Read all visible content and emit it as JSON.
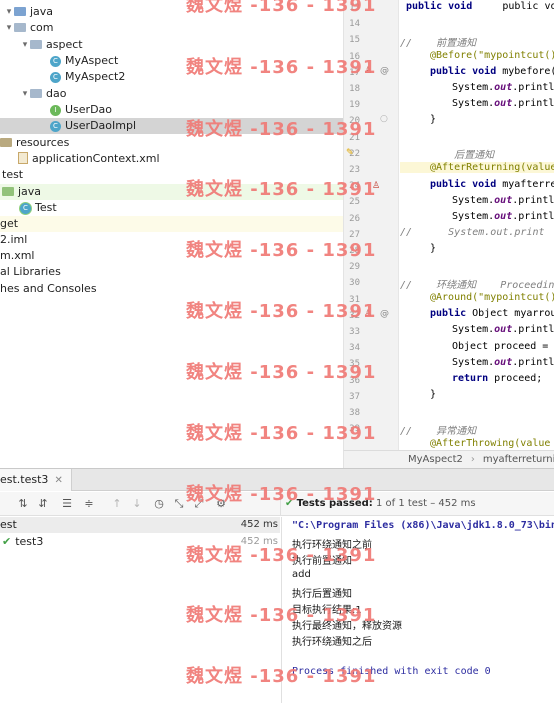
{
  "project_tree": [
    {
      "label": "java",
      "icon": "folder-icon",
      "indent": 0
    },
    {
      "label": "com",
      "icon": "folder-icon",
      "indent": 1
    },
    {
      "label": "aspect",
      "icon": "folder-icon",
      "indent": 2
    },
    {
      "label": "MyAspect",
      "icon": "class-icon",
      "indent": 3
    },
    {
      "label": "MyAspect2",
      "icon": "class-icon",
      "indent": 3
    },
    {
      "label": "dao",
      "icon": "folder-icon",
      "indent": 2
    },
    {
      "label": "UserDao",
      "icon": "interface-icon",
      "indent": 3
    },
    {
      "label": "UserDaoImpl",
      "icon": "class-icon",
      "indent": 3
    },
    {
      "label": "resources",
      "icon": "resources-folder-icon",
      "indent": 0
    },
    {
      "label": "applicationContext.xml",
      "icon": "xml-icon",
      "indent": 1
    },
    {
      "label": "test",
      "icon": "folder-icon",
      "indent": 0
    },
    {
      "label": "java",
      "icon": "test-folder-icon",
      "indent": 1
    },
    {
      "label": "Test",
      "icon": "test-class-icon",
      "indent": 2
    },
    {
      "label": "get",
      "icon": "folder-icon",
      "indent": 0
    },
    {
      "label": "2.iml",
      "icon": "file-icon",
      "indent": 0
    },
    {
      "label": "m.xml",
      "icon": "file-icon",
      "indent": 0
    },
    {
      "label": "al Libraries",
      "icon": "library-icon",
      "indent": 0
    },
    {
      "label": "hes and Consoles",
      "icon": "console-icon",
      "indent": 0
    }
  ],
  "editor": {
    "line_numbers": [
      "13",
      "14",
      "15",
      "16",
      "17",
      "18",
      "19",
      "20",
      "21",
      "22",
      "23",
      "24",
      "25",
      "26",
      "27",
      "28",
      "29",
      "30",
      "31",
      "32",
      "33",
      "34",
      "35",
      "36",
      "37",
      "38",
      "39"
    ],
    "lines": {
      "l13": "    public void mypointcut",
      "l15": "//    前置通知",
      "l16_ann": "@Before(\"mypointcut()\"",
      "l17_kw": "public void ",
      "l17_rest": "mybefore(J",
      "l18_a": "System.",
      "l18_fld": "out",
      "l18_b": ".println",
      "l19_a": "System.",
      "l19_fld": "out",
      "l19_b": ".println",
      "l20": "}",
      "l22": "    后置通知",
      "l23_ann": "@AfterReturning(value",
      "l24_kw": "public void ",
      "l24_rest": "myafterret",
      "l25_a": "System.",
      "l25_fld": "out",
      "l25_b": ".println",
      "l26_a": "System.",
      "l26_fld": "out",
      "l26_b": ".println",
      "l27": "//      System.out.print",
      "l28": "}",
      "l30": "//    环绕通知    Proceedin",
      "l31_ann": "@Around(\"mypointcut()\"",
      "l32_kw": "public ",
      "l32_rest": "Object myarroun",
      "l33_a": "System.",
      "l33_fld": "out",
      "l33_b": ".println",
      "l34": "Object proceed = p",
      "l35_a": "System.",
      "l35_fld": "out",
      "l35_b": ".println",
      "l36_kw": "return ",
      "l36_rest": "proceed;",
      "l37": "}",
      "l39": "//    异常通知",
      "l40_ann": "@AfterThrowing(value ="
    },
    "breadcrumb": [
      "MyAspect2",
      "myafterreturnin"
    ]
  },
  "run_panel": {
    "tab_label": "est.test3",
    "status_label": "Tests passed:",
    "status_rest": " 1 of 1 test – 452 ms",
    "tests": [
      {
        "name": "est",
        "time": "452 ms",
        "root": true
      },
      {
        "name": "test3",
        "time": "452 ms",
        "root": false
      }
    ],
    "console_command": "\"C:\\Program Files (x86)\\Java\\jdk1.8.0_73\\bin\\",
    "console_lines": [
      "执行环绕通知之前",
      "执行前置通知",
      "add",
      "执行后置通知",
      "目标执行结果:1",
      "执行最终通知，释放资源",
      "执行环绕通知之后"
    ],
    "console_exit": "Process finished with exit code 0"
  },
  "watermark": {
    "text": "魏文煜 -136 - 1391",
    "color": "#f07a76"
  },
  "colors": {
    "selection": "#d4d4d4",
    "test_green": "#43a047",
    "annotation": "#808000",
    "keyword": "#000080"
  }
}
